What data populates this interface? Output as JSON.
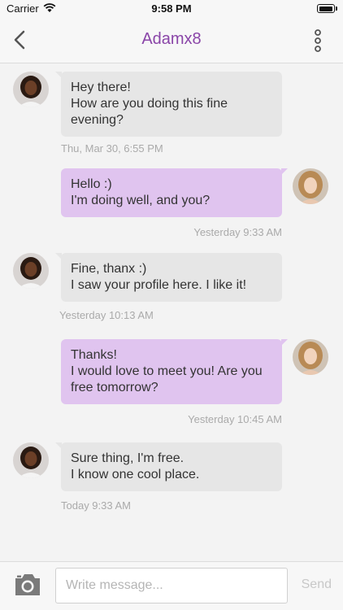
{
  "status_bar": {
    "carrier": "Carrier",
    "time": "9:58 PM",
    "battery_level": 1.0
  },
  "header": {
    "title": "Adamx8",
    "back_icon": "chevron-left-icon",
    "menu_icon": "vertical-dots-icon"
  },
  "messages": [
    {
      "direction": "incoming",
      "text": "Hey there!\nHow are you doing this fine evening?",
      "timestamp": "Thu, Mar 30, 6:55 PM"
    },
    {
      "direction": "outgoing",
      "text": "Hello :)\nI'm doing well, and you?",
      "timestamp": "Yesterday 9:33 AM"
    },
    {
      "direction": "incoming",
      "text": "Fine, thanx :)\nI saw your profile here. I like it!",
      "timestamp": "Yesterday 10:13 AM"
    },
    {
      "direction": "outgoing",
      "text": "Thanks!\nI would love to meet you! Are you free tomorrow?",
      "timestamp": "Yesterday 10:45 AM"
    },
    {
      "direction": "incoming",
      "text": "Sure thing, I'm free.\nI know one cool place.",
      "timestamp": "Today 9:33 AM"
    }
  ],
  "composer": {
    "placeholder": "Write message...",
    "send_label": "Send",
    "camera_icon": "camera-icon"
  },
  "colors": {
    "accent": "#8a45a8",
    "incoming_bubble": "#e6e6e6",
    "outgoing_bubble": "#e0c4ef"
  }
}
